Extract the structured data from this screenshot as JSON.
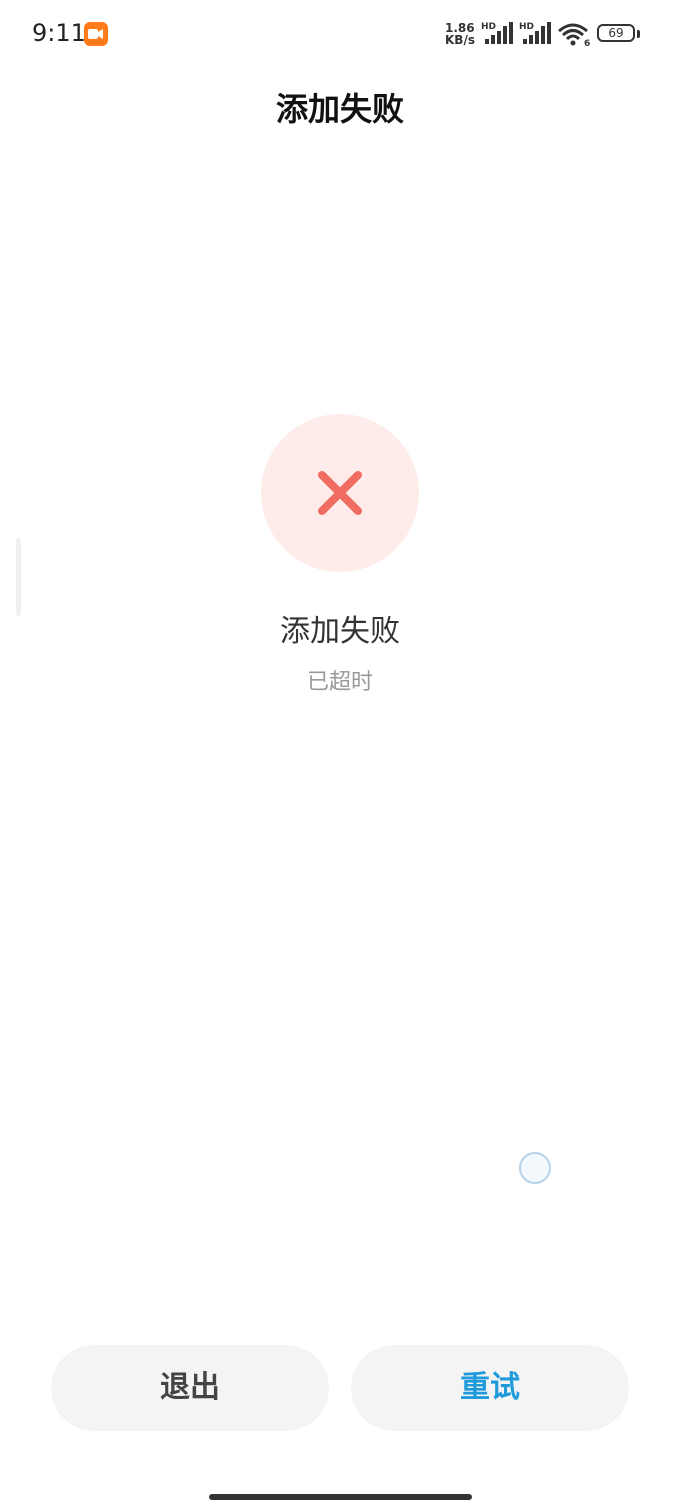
{
  "status_bar": {
    "time": "9:11",
    "net_speed_value": "1.86",
    "net_speed_unit": "KB/s",
    "sim1_label": "HD",
    "sim2_label": "HD",
    "battery_level": "69",
    "recording_icon": "screen-record-icon",
    "wifi_icon": "wifi-icon",
    "wifi_badge": "6"
  },
  "header": {
    "title": "添加失败"
  },
  "result": {
    "icon": "close-x-icon",
    "icon_color": "#f26d61",
    "circle_color": "#fdecea",
    "title": "添加失败",
    "subtitle": "已超时"
  },
  "actions": {
    "exit_label": "退出",
    "retry_label": "重试",
    "retry_color": "#1f9bdc"
  }
}
